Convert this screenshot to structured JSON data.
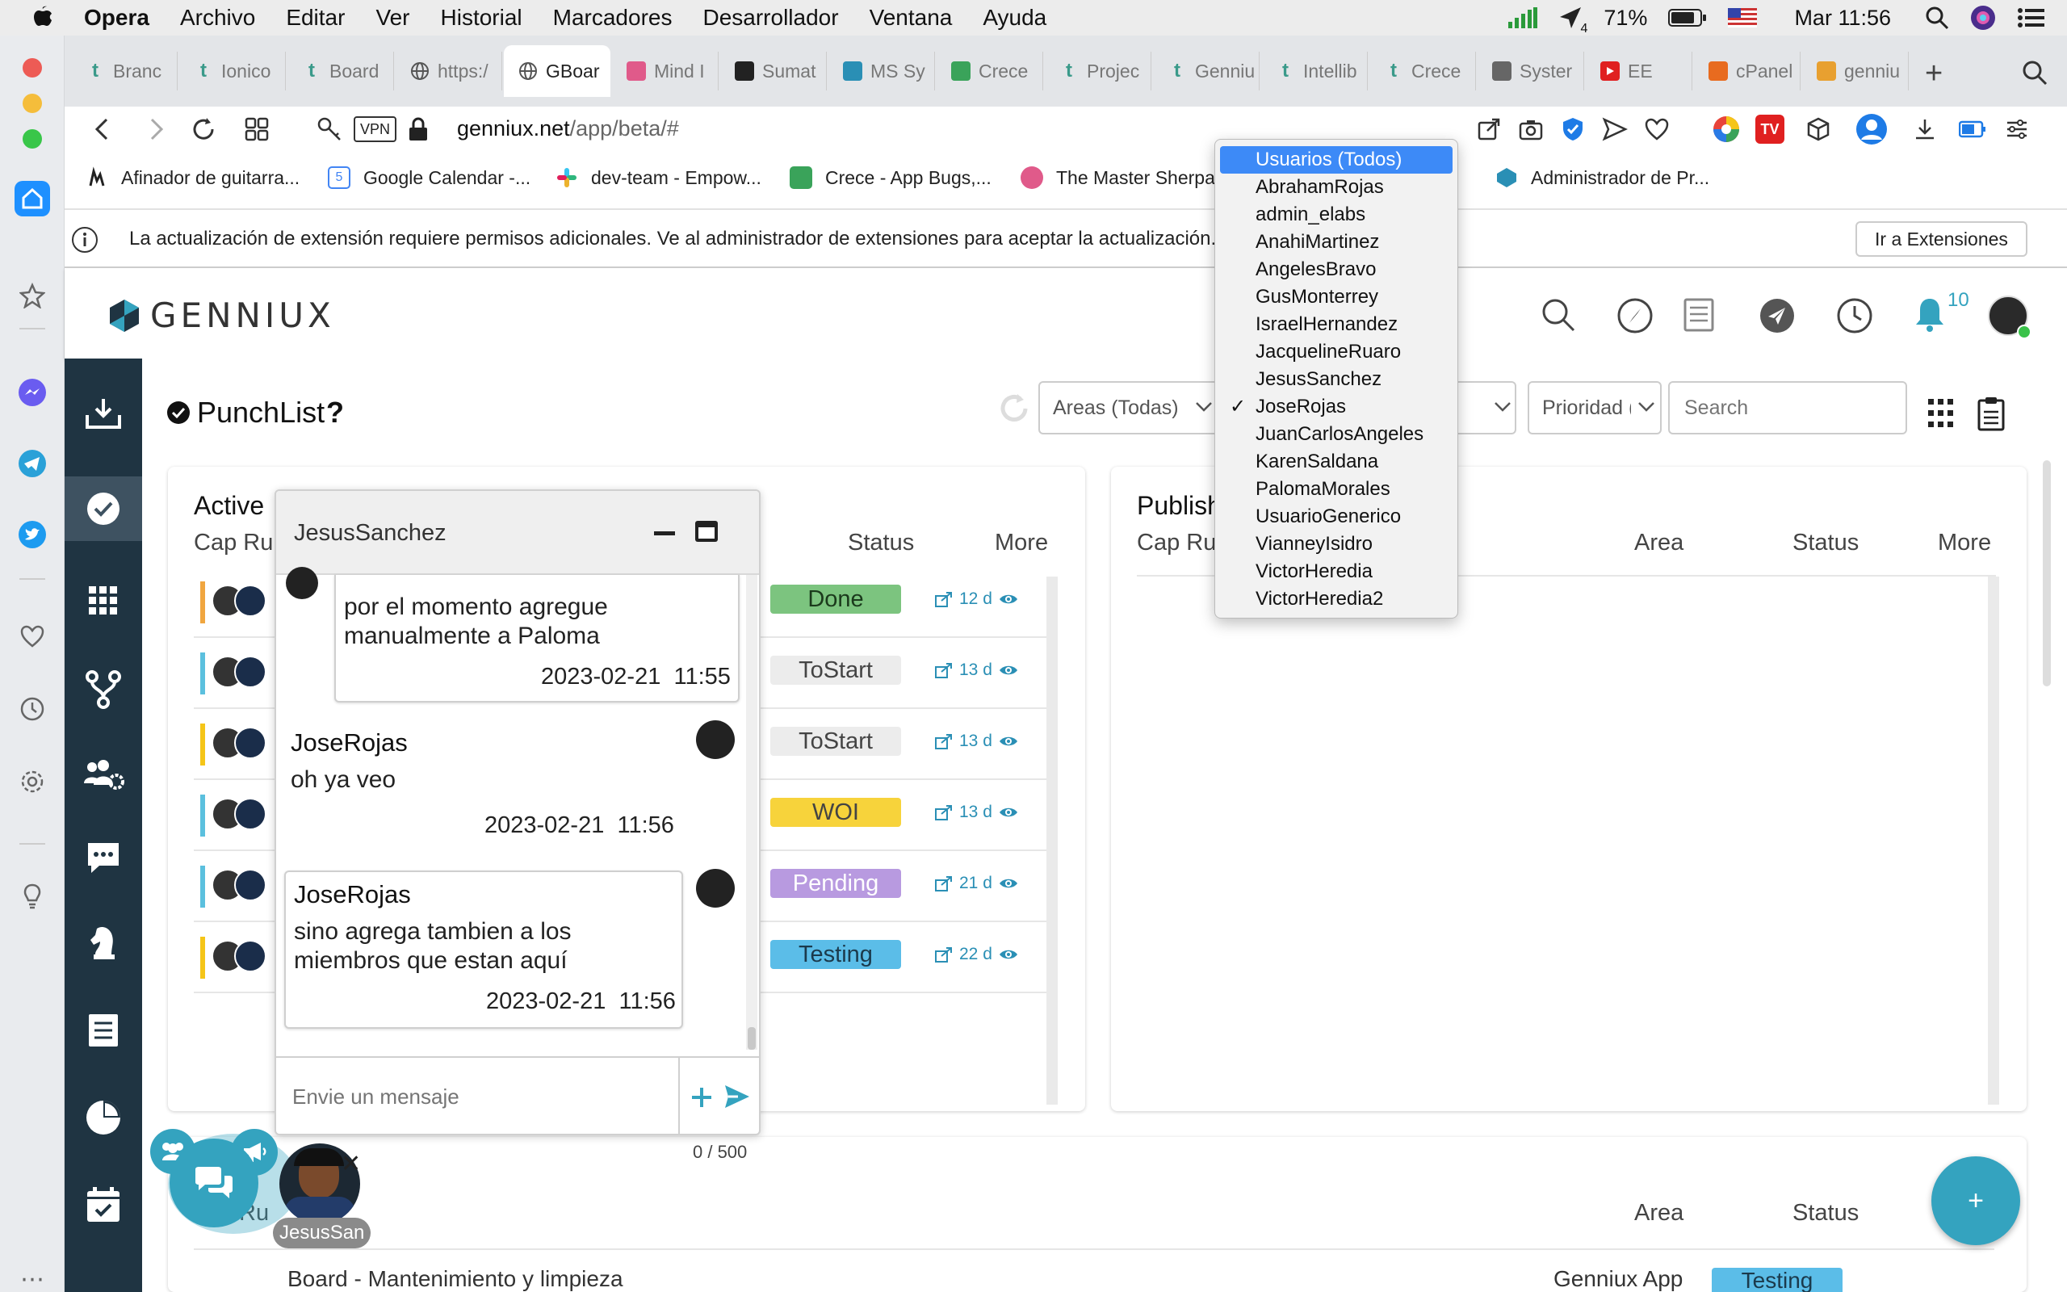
{
  "menubar": {
    "app": "Opera",
    "items": [
      "Archivo",
      "Editar",
      "Ver",
      "Historial",
      "Marcadores",
      "Desarrollador",
      "Ventana",
      "Ayuda"
    ],
    "battery": "71%",
    "clock": "Mar 11:56",
    "wifi_badge": "4"
  },
  "tabs": [
    {
      "label": "Branc",
      "icon_color": "#3a9a8a",
      "icon": "t"
    },
    {
      "label": "Ionico",
      "icon_color": "#3a9a8a",
      "icon": "t"
    },
    {
      "label": "Board",
      "icon_color": "#3a9a8a",
      "icon": "t"
    },
    {
      "label": "https:/",
      "icon_color": "#555555",
      "icon": "globe"
    },
    {
      "label": "GBoar",
      "icon_color": "#555555",
      "icon": "globe",
      "active": true
    },
    {
      "label": "Mind I",
      "icon_color": "#e05a8a",
      "icon": "m"
    },
    {
      "label": "Sumat",
      "icon_color": "#222222",
      "icon": "A"
    },
    {
      "label": "MS Sy",
      "icon_color": "#2a8fb5",
      "icon": "g"
    },
    {
      "label": "Crece",
      "icon_color": "#3aa35a",
      "icon": "+"
    },
    {
      "label": "Projec",
      "icon_color": "#3a9a8a",
      "icon": "t"
    },
    {
      "label": "Genniu",
      "icon_color": "#3a9a8a",
      "icon": "t"
    },
    {
      "label": "Intellib",
      "icon_color": "#3a9a8a",
      "icon": "t"
    },
    {
      "label": "Crece",
      "icon_color": "#3a9a8a",
      "icon": "t"
    },
    {
      "label": "Syster",
      "icon_color": "#666666",
      "icon": "s"
    },
    {
      "label": "EE",
      "icon_color": "#e02020",
      "icon": "yt"
    },
    {
      "label": "cPanel",
      "icon_color": "#e86b1f",
      "icon": "cP"
    },
    {
      "label": "genniu",
      "icon_color": "#e8a030",
      "icon": "p"
    }
  ],
  "address": {
    "vpn": "VPN",
    "url_host": "genniux.net",
    "url_path": "/app/beta/#"
  },
  "bookmarks": [
    {
      "label": "Afinador de guitarra...",
      "color": "#222222"
    },
    {
      "label": "Google Calendar -...",
      "color": "#4285f4"
    },
    {
      "label": "dev-team - Empow...",
      "color": "#e01e5a"
    },
    {
      "label": "Crece - App Bugs,...",
      "color": "#3aa35a"
    },
    {
      "label": "The Master Sherpa",
      "color": "#e05a8a"
    },
    {
      "label": "Administrador de Pr...",
      "color": "#2a8fb5"
    }
  ],
  "infobar": {
    "message": "La actualización de extensión requiere permisos adicionales. Ve al administrador de extensiones para aceptar la actualización.",
    "button": "Ir a Extensiones"
  },
  "app": {
    "logo": "GENNIUX",
    "notifications": "10",
    "page_title": "PunchList",
    "help": "?",
    "filters": {
      "areas": "Areas (Todas)",
      "priority": "Prioridad (",
      "search_placeholder": "Search"
    },
    "active_panel": {
      "title": "Active",
      "columns": [
        "Cap Ru",
        "Status",
        "More"
      ]
    },
    "publish_panel": {
      "title": "Publish",
      "columns": [
        "Cap Ru",
        "Area",
        "Status",
        "More"
      ]
    },
    "bottom_panel": {
      "columns": [
        "Ru",
        "Area",
        "Status"
      ],
      "row_text": "Board - Mantenimiento y limpieza",
      "row_area": "Genniux App",
      "row_status": "Testing"
    },
    "rows": [
      {
        "status": "Done",
        "bg": "#7cc47f",
        "fg": "#1b3a1c",
        "days": "12 d",
        "bar": "#f0a640"
      },
      {
        "status": "ToStart",
        "bg": "#ececec",
        "fg": "#444444",
        "days": "13 d",
        "bar": "#5bc0de"
      },
      {
        "status": "ToStart",
        "bg": "#ececec",
        "fg": "#444444",
        "days": "13 d",
        "bar": "#f5c518"
      },
      {
        "status": "WOI",
        "bg": "#f7d33b",
        "fg": "#444444",
        "days": "13 d",
        "bar": "#5bc0de"
      },
      {
        "status": "Pending",
        "bg": "#b89ae0",
        "fg": "#ffffff",
        "days": "21 d",
        "bar": "#5bc0de"
      },
      {
        "status": "Testing",
        "bg": "#5bbde8",
        "fg": "#1b3a4c",
        "days": "22 d",
        "bar": "#f5c518"
      }
    ],
    "fab": "+"
  },
  "chat": {
    "title": "JesusSanchez",
    "messages": [
      {
        "name": "",
        "text": "por el momento agregue manualmente a Paloma",
        "date": "2023-02-21",
        "time": "11:55"
      },
      {
        "name": "JoseRojas",
        "text": "oh ya veo",
        "date": "2023-02-21",
        "time": "11:56"
      },
      {
        "name": "JoseRojas",
        "text": "sino agrega tambien a los miembros que estan aquí",
        "date": "2023-02-21",
        "time": "11:56"
      }
    ],
    "input_placeholder": "Envie un mensaje",
    "counter": "0 / 500",
    "bubble_user": "JesusSan"
  },
  "user_dropdown": {
    "selected": "JoseRojas",
    "highlighted": "Usuarios (Todos)",
    "options": [
      "Usuarios (Todos)",
      "AbrahamRojas",
      "admin_elabs",
      "AnahiMartinez",
      "AngelesBravo",
      "GusMonterrey",
      "IsraelHernandez",
      "JacquelineRuaro",
      "JesusSanchez",
      "JoseRojas",
      "JuanCarlosAngeles",
      "KarenSaldana",
      "PalomaMorales",
      "UsuarioGenerico",
      "VianneyIsidro",
      "VictorHeredia",
      "VictorHeredia2"
    ]
  }
}
